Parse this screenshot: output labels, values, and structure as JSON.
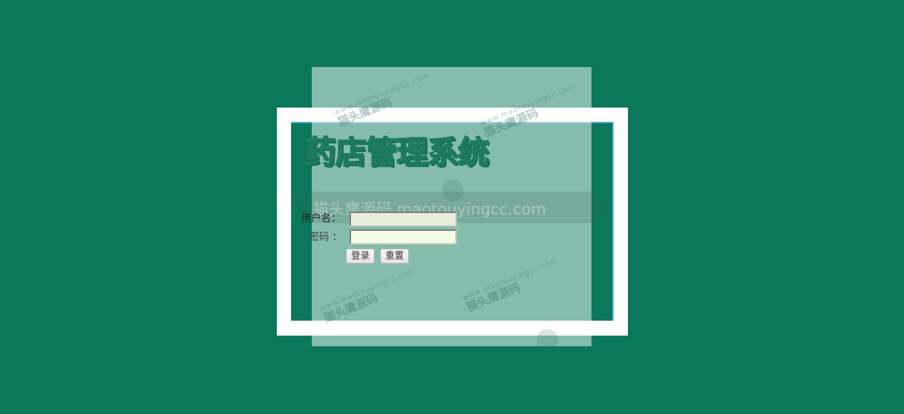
{
  "app": {
    "title": "药店管理系统"
  },
  "watermark": {
    "band_text": "猫头鹰源码 maotouyingcc.com",
    "url_text": "www.maotouyingcc.com",
    "cn_text": "猫头鹰源码"
  },
  "form": {
    "username_label": "用户名：",
    "password_label": "密码 ：",
    "username_value": "",
    "password_value": "",
    "login_label": "登录",
    "reset_label": "重置"
  },
  "colors": {
    "background": "#0b785c",
    "frame": "#ffffff",
    "frame_accent": "#4fa5d8",
    "title_text": "#ffffff"
  },
  "icons": {
    "mascot": "owl-watermark-icon"
  }
}
